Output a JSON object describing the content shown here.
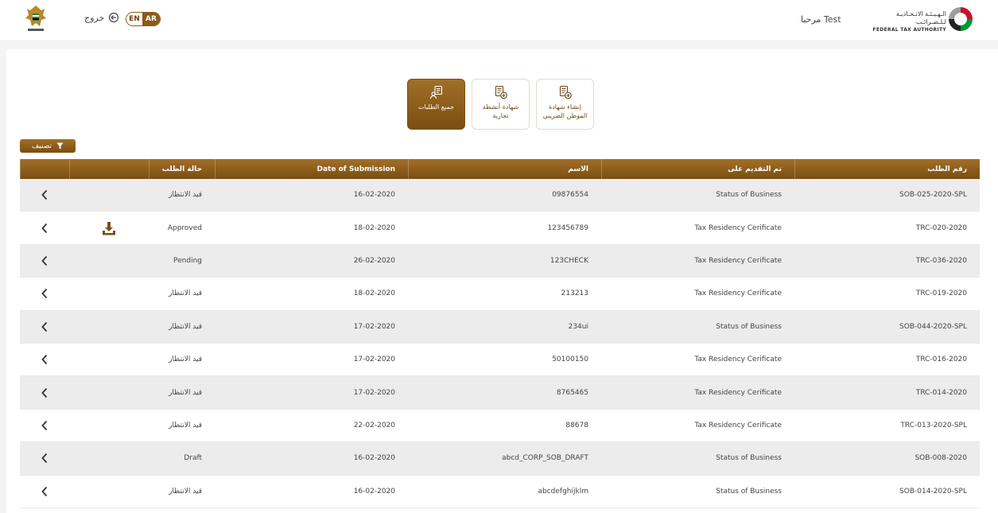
{
  "header": {
    "logout_label": "خروج",
    "lang_en": "EN",
    "lang_ar": "AR",
    "welcome": "مرحبا Test",
    "fta_ar": "الـهـيـئـة الاتـحـاديـة لـلـضـرائـب",
    "fta_en": "FEDERAL TAX AUTHORITY"
  },
  "cards": [
    {
      "label": "جميع الطلبات",
      "active": true
    },
    {
      "label": "شهادة أنشطة تجارية",
      "active": false
    },
    {
      "label": "إنشاء شهادة الموطن الضريبي",
      "active": false
    }
  ],
  "filter_label": "تصنيف",
  "table": {
    "headers": {
      "status": "حالة الطلب",
      "date": "Date of Submission",
      "name": "الاسم",
      "type": "تم التقديم على",
      "number": "رقم الطلب"
    },
    "rows": [
      {
        "number": "SOB-025-2020-SPL",
        "type": "Status of Business",
        "name": "09876554",
        "date": "16-02-2020",
        "status": "قيد الانتظار",
        "download": false
      },
      {
        "number": "TRC-020-2020",
        "type": "Tax Residency Cerificate",
        "name": "123456789",
        "date": "18-02-2020",
        "status": "Approved",
        "download": true
      },
      {
        "number": "TRC-036-2020",
        "type": "Tax Residency Cerificate",
        "name": "123CHECK",
        "date": "26-02-2020",
        "status": "Pending",
        "download": false
      },
      {
        "number": "TRC-019-2020",
        "type": "Tax Residency Cerificate",
        "name": "213213",
        "date": "18-02-2020",
        "status": "قيد الانتظار",
        "download": false
      },
      {
        "number": "SOB-044-2020-SPL",
        "type": "Status of Business",
        "name": "234ui",
        "date": "17-02-2020",
        "status": "قيد الانتظار",
        "download": false
      },
      {
        "number": "TRC-016-2020",
        "type": "Tax Residency Cerificate",
        "name": "50100150",
        "date": "17-02-2020",
        "status": "قيد الانتظار",
        "download": false
      },
      {
        "number": "TRC-014-2020",
        "type": "Tax Residency Cerificate",
        "name": "8765465",
        "date": "17-02-2020",
        "status": "قيد الانتظار",
        "download": false
      },
      {
        "number": "TRC-013-2020-SPL",
        "type": "Tax Residency Cerificate",
        "name": "88678",
        "date": "22-02-2020",
        "status": "قيد الانتظار",
        "download": false
      },
      {
        "number": "SOB-008-2020",
        "type": "Status of Business",
        "name": "abcd_CORP_SOB_DRAFT",
        "date": "16-02-2020",
        "status": "Draft",
        "download": false
      },
      {
        "number": "SOB-014-2020-SPL",
        "type": "Status of Business",
        "name": "abcdefghijklm",
        "date": "16-02-2020",
        "status": "قيد الانتظار",
        "download": false
      }
    ]
  },
  "colors": {
    "accent": "#8b5a18",
    "accent_dark": "#7a4e12"
  }
}
